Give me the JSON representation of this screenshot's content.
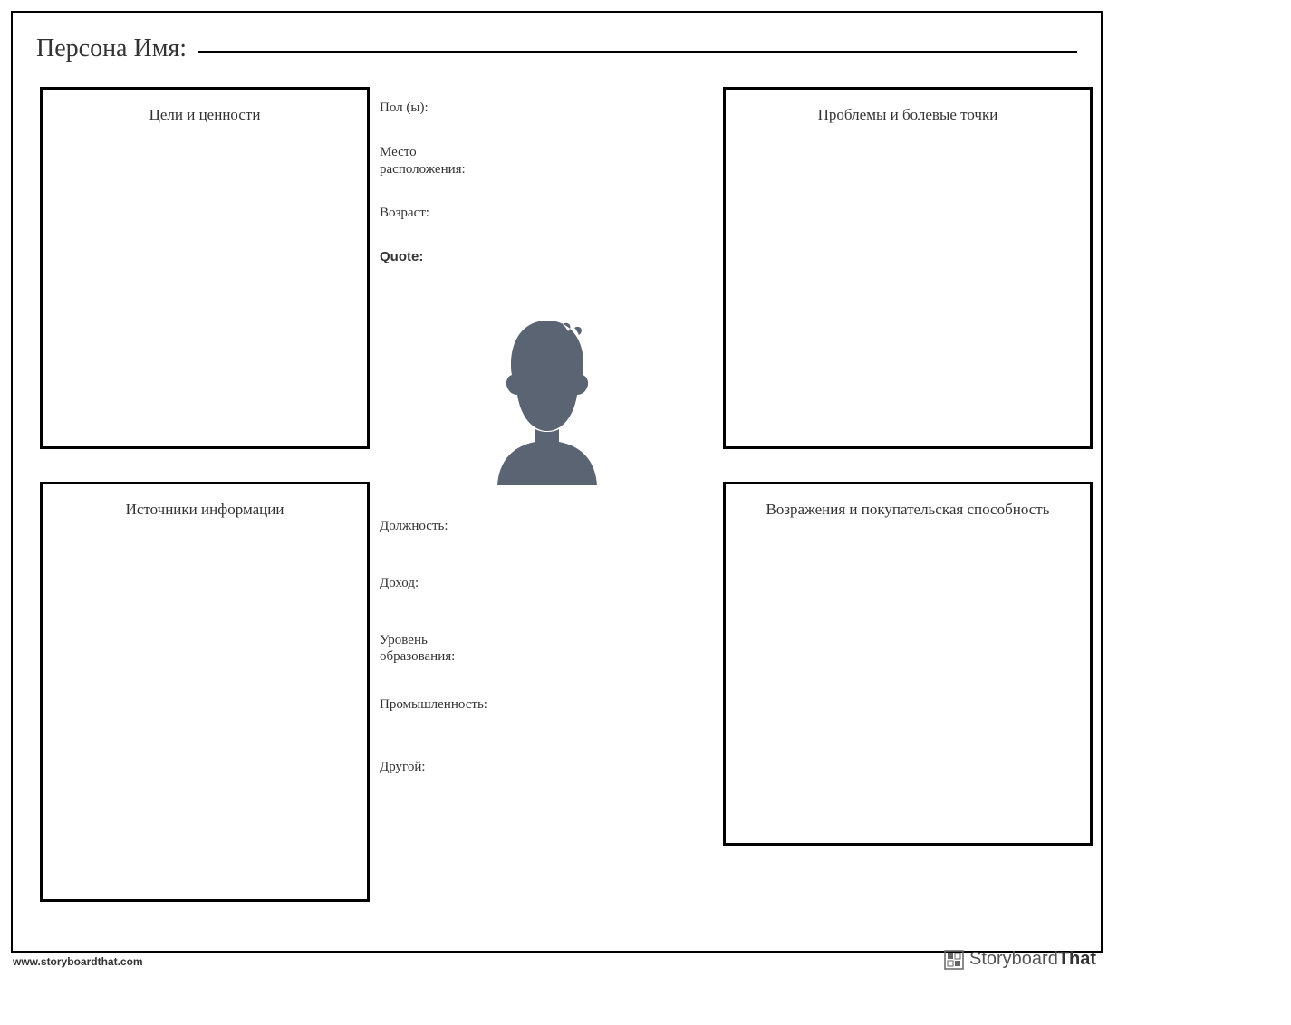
{
  "header": {
    "name_label": "Персона Имя:"
  },
  "boxes": {
    "goals": "Цели и ценности",
    "problems": "Проблемы и болевые точки",
    "sources": "Источники информации",
    "objections": "Возражения и покупательская способность"
  },
  "fields_top": {
    "gender": "Пол (ы):",
    "location": "Место расположения:",
    "age": "Возраст:",
    "quote": "Quote:"
  },
  "fields_bottom": {
    "job_title": "Должность:",
    "income": "Доход:",
    "education": "Уровень образования:",
    "industry": "Промышленность:",
    "other": "Другой:"
  },
  "footer": {
    "url": "www.storyboardthat.com",
    "brand_part1": "Storyboard",
    "brand_part2": "That"
  }
}
